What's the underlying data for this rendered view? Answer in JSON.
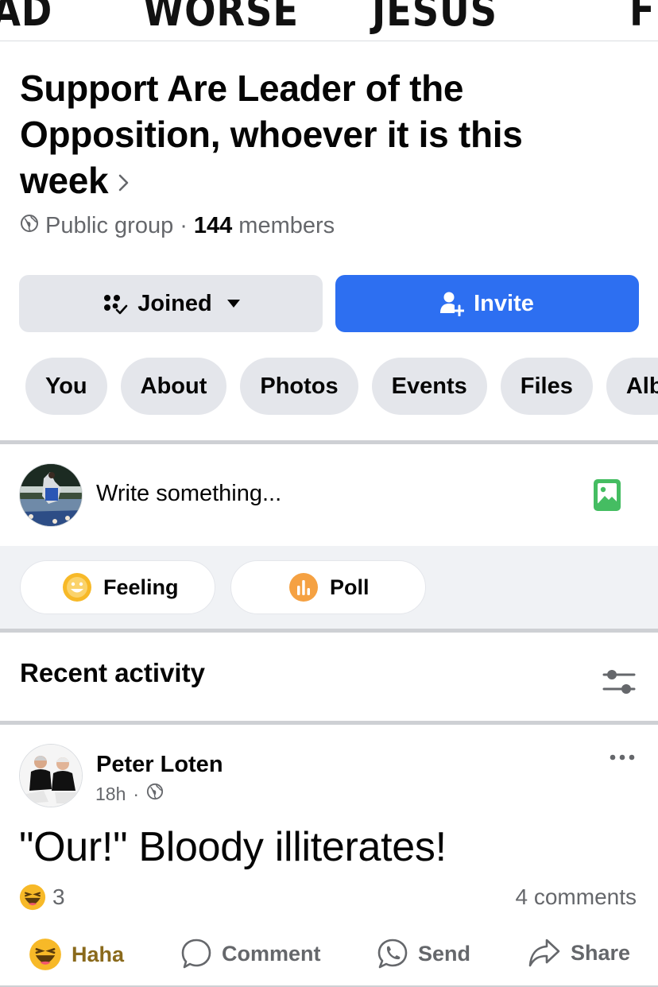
{
  "cover": {
    "words": [
      "AD",
      "WORSE",
      "JESUS",
      "FI"
    ]
  },
  "group": {
    "title": "Support Are Leader of the Opposition, whoever it is this week",
    "privacy": "Public group",
    "separator": "·",
    "member_count": "144",
    "members_label": "members"
  },
  "actions": {
    "joined_label": "Joined",
    "invite_label": "Invite"
  },
  "tabs": [
    "You",
    "About",
    "Photos",
    "Events",
    "Files",
    "Alb"
  ],
  "composer": {
    "placeholder": "Write something...",
    "feeling_label": "Feeling",
    "poll_label": "Poll"
  },
  "recent": {
    "title": "Recent activity"
  },
  "post": {
    "author": "Peter Loten",
    "time": "18h",
    "separator": "·",
    "text": "\"Our!\" Bloody illiterates!",
    "reaction_count": "3",
    "comments": "4 comments",
    "actions": {
      "haha": "Haha",
      "comment": "Comment",
      "send": "Send",
      "share": "Share"
    }
  },
  "colors": {
    "accent": "#2d6ff1",
    "muted": "#65676b",
    "chip_bg": "#e4e6eb",
    "photo_green": "#45bd62",
    "haha_yellow": "#f7b928"
  },
  "icons": [
    "globe-icon",
    "chevron-right-icon",
    "joined-group-icon",
    "caret-down-icon",
    "add-person-icon",
    "photo-icon",
    "feeling-icon",
    "poll-icon",
    "filter-icon",
    "more-icon",
    "haha-icon",
    "comment-icon",
    "messenger-icon",
    "share-icon"
  ]
}
